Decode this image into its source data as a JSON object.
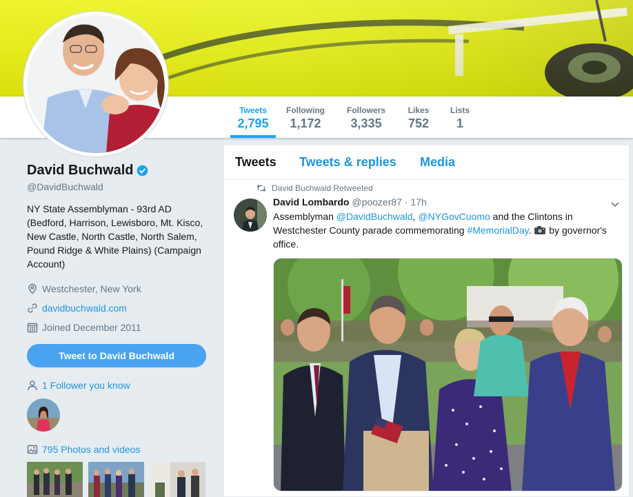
{
  "profile": {
    "name": "David Buchwald",
    "handle": "@DavidBuchwald",
    "bio": "NY State Assemblyman - 93rd AD (Bedford, Harrison, Lewisboro, Mt. Kisco, New Castle, North Castle, North Salem, Pound Ridge & White Plains) (Campaign Account)",
    "location": "Westchester, New York",
    "website": "davidbuchwald.com",
    "joined": "Joined December 2011",
    "tweet_to_label": "Tweet to David Buchwald",
    "followers_you_know": "1 Follower you know",
    "photos_videos": "795 Photos and videos"
  },
  "stats": [
    {
      "label": "Tweets",
      "value": "2,795"
    },
    {
      "label": "Following",
      "value": "1,172"
    },
    {
      "label": "Followers",
      "value": "3,335"
    },
    {
      "label": "Likes",
      "value": "752"
    },
    {
      "label": "Lists",
      "value": "1"
    }
  ],
  "tabs": [
    "Tweets",
    "Tweets & replies",
    "Media"
  ],
  "tweet": {
    "retweet_context": "David Buchwald Retweeted",
    "author_name": "David Lombardo",
    "author_handle": "@poozer87",
    "dot": "·",
    "time": "17h",
    "text_parts": {
      "p1": "Assemblyman ",
      "m1": "@DavidBuchwald",
      "p2": ", ",
      "m2": "@NYGovCuomo",
      "p3": " and the Clintons in Westchester County parade commemorating ",
      "h1": "#MemorialDay",
      "p4": ". ",
      "p5": " by governor's office."
    }
  },
  "colors": {
    "accent": "#1da1f2",
    "link": "#1b95e0",
    "banner": "#e9f214",
    "button": "#4aa3f0"
  }
}
